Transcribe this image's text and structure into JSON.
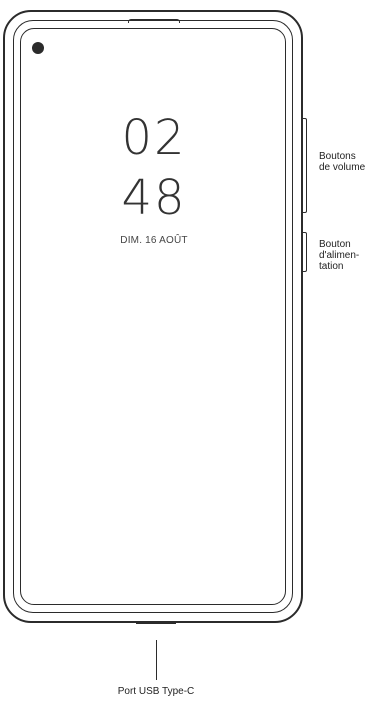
{
  "lockscreen": {
    "hour": "02",
    "minute": "48",
    "date": "DIM. 16 AOÛT"
  },
  "labels": {
    "volume": [
      "Boutons",
      "de volume"
    ],
    "power": [
      "Bouton",
      "d'alimen-",
      "tation"
    ],
    "usb": "Port USB Type-C"
  }
}
